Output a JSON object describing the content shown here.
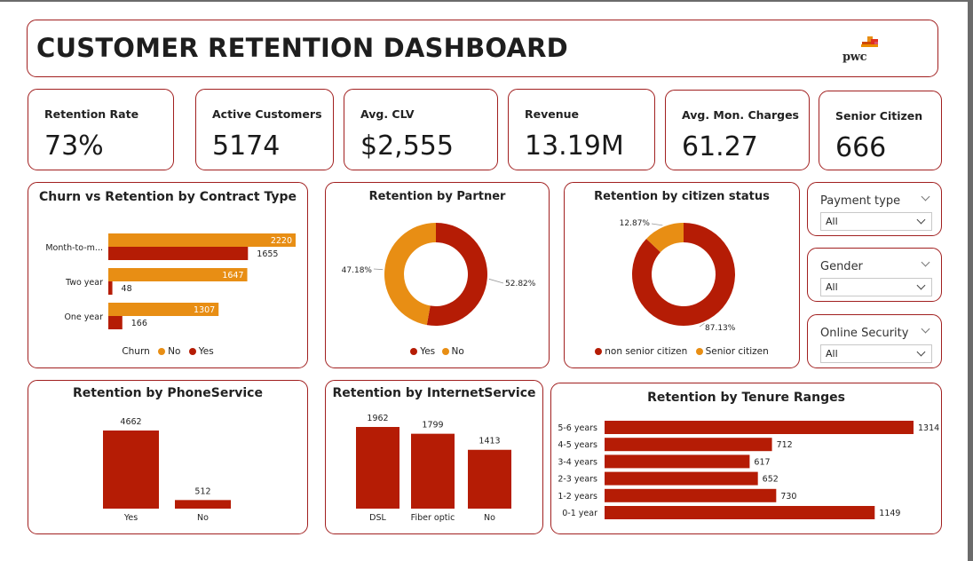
{
  "dashboard": {
    "title": "CUSTOMER RETENTION DASHBOARD",
    "logo_text": "pwc"
  },
  "colors": {
    "primary": "#b51c05",
    "secondary": "#e88e14",
    "border": "#a11f1f"
  },
  "kpis": [
    {
      "label": "Retention Rate",
      "value": "73%"
    },
    {
      "label": "Active Customers",
      "value": "5174"
    },
    {
      "label": "Avg. CLV",
      "value": "$2,555"
    },
    {
      "label": "Revenue",
      "value": "13.19M"
    },
    {
      "label": "Avg. Mon. Charges",
      "value": "61.27"
    },
    {
      "label": "Senior Citizen",
      "value": "666"
    }
  ],
  "slicers": [
    {
      "label": "Payment type",
      "value": "All"
    },
    {
      "label": "Gender",
      "value": "All"
    },
    {
      "label": "Online Security",
      "value": "All"
    }
  ],
  "chart_data": [
    {
      "id": "contract",
      "type": "bar",
      "orientation": "horizontal",
      "title": "Churn vs Retention by Contract Type",
      "categories": [
        "Month-to-m...",
        "Two year",
        "One year"
      ],
      "series": [
        {
          "name": "No",
          "color": "#e88e14",
          "values": [
            2220,
            1647,
            1307
          ]
        },
        {
          "name": "Yes",
          "color": "#b51c05",
          "values": [
            1655,
            48,
            166
          ]
        }
      ],
      "legend_title": "Churn",
      "legend_position": "bottom"
    },
    {
      "id": "partner",
      "type": "pie",
      "donut": true,
      "title": "Retention by Partner",
      "slices": [
        {
          "name": "Yes",
          "value": 52.82,
          "label": "52.82%",
          "color": "#b51c05"
        },
        {
          "name": "No",
          "value": 47.18,
          "label": "47.18%",
          "color": "#e88e14"
        }
      ],
      "legend_position": "bottom"
    },
    {
      "id": "citizen",
      "type": "pie",
      "donut": true,
      "title": "Retention by citizen status",
      "slices": [
        {
          "name": "non senior citizen",
          "value": 87.13,
          "label": "87.13%",
          "color": "#b51c05"
        },
        {
          "name": "Senior citizen",
          "value": 12.87,
          "label": "12.87%",
          "color": "#e88e14"
        }
      ],
      "legend_position": "bottom"
    },
    {
      "id": "phone",
      "type": "bar",
      "title": "Retention by PhoneService",
      "categories": [
        "Yes",
        "No"
      ],
      "values": [
        4662,
        512
      ],
      "color": "#b51c05"
    },
    {
      "id": "internet",
      "type": "bar",
      "title": "Retention by InternetService",
      "categories": [
        "DSL",
        "Fiber optic",
        "No"
      ],
      "values": [
        1962,
        1799,
        1413
      ],
      "color": "#b51c05"
    },
    {
      "id": "tenure",
      "type": "bar",
      "orientation": "horizontal",
      "title": "Retention by Tenure Ranges",
      "categories": [
        "5-6 years",
        "4-5 years",
        "3-4 years",
        "2-3 years",
        "1-2 years",
        "0-1 year"
      ],
      "values": [
        1314,
        712,
        617,
        652,
        730,
        1149
      ],
      "color": "#b51c05"
    }
  ]
}
